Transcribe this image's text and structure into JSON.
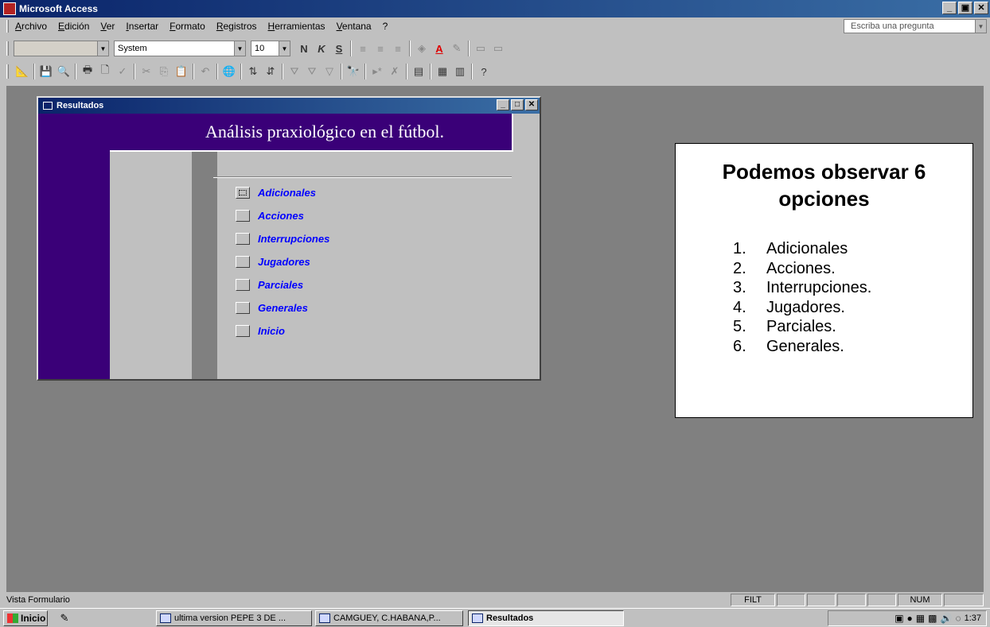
{
  "window": {
    "title": "Microsoft Access",
    "minimize": "_",
    "restore": "▣",
    "close": "✕"
  },
  "menu": {
    "items": [
      "Archivo",
      "Edición",
      "Ver",
      "Insertar",
      "Formato",
      "Registros",
      "Herramientas",
      "Ventana",
      "?"
    ],
    "ask_placeholder": "Escriba una pregunta"
  },
  "format_toolbar": {
    "object_combo": "",
    "font": "System",
    "size": "10",
    "bold": "N",
    "italic": "K",
    "underline": "S"
  },
  "form_window": {
    "title": "Resultados",
    "heading": "Análisis praxiológico en el fútbol.",
    "options": [
      "Adicionales",
      "Acciones",
      "Interrupciones",
      "Jugadores",
      "Parciales",
      "Generales",
      "Inicio"
    ]
  },
  "note": {
    "title": "Podemos observar 6 opciones",
    "items": [
      {
        "n": "1.",
        "label": "Adicionales"
      },
      {
        "n": "2.",
        "label": "Acciones."
      },
      {
        "n": "3.",
        "label": "Interrupciones."
      },
      {
        "n": "4.",
        "label": "Jugadores."
      },
      {
        "n": "5.",
        "label": "Parciales."
      },
      {
        "n": "6.",
        "label": "Generales."
      }
    ]
  },
  "status": {
    "text": "Vista Formulario",
    "filt": "FILT",
    "num": "NUM"
  },
  "taskbar": {
    "start": "Inicio",
    "tasks": [
      "ultima version PEPE 3 DE ...",
      "CAMGUEY, C.HABANA,P...",
      "Resultados"
    ],
    "time": "1:37"
  },
  "colors": {
    "form_purple": "#3a0078",
    "option_text": "#0000ff",
    "workspace": "#808080"
  }
}
